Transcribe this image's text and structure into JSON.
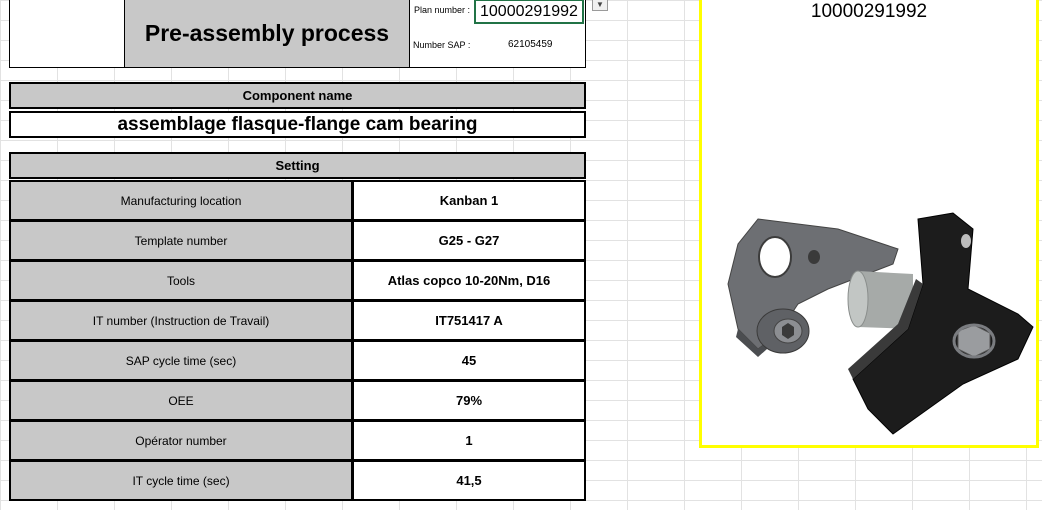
{
  "header": {
    "title": "Pre-assembly process",
    "plan_number_label": "Plan number :",
    "plan_number_value": "10000291992",
    "number_sap_label": "Number SAP :",
    "number_sap_value": "62105459"
  },
  "component": {
    "header": "Component name",
    "name": "assemblage flasque-flange cam bearing"
  },
  "setting": {
    "header": "Setting",
    "rows": [
      {
        "label": "Manufacturing location",
        "value": "Kanban 1"
      },
      {
        "label": "Template number",
        "value": "G25 - G27"
      },
      {
        "label": "Tools",
        "value": "Atlas copco 10-20Nm, D16"
      },
      {
        "label": "IT number (Instruction de Travail)",
        "value": "IT751417 A"
      },
      {
        "label": "SAP cycle time (sec)",
        "value": "45"
      },
      {
        "label": "OEE",
        "value": "79%"
      },
      {
        "label": "Opérator number",
        "value": "1"
      },
      {
        "label": "IT cycle time (sec)",
        "value": "41,5"
      }
    ]
  },
  "image_panel": {
    "plan_number": "10000291992",
    "border_color": "#ffff00"
  },
  "icons": {
    "dropdown": "chevron-down-icon",
    "part": "part-render-icon"
  }
}
